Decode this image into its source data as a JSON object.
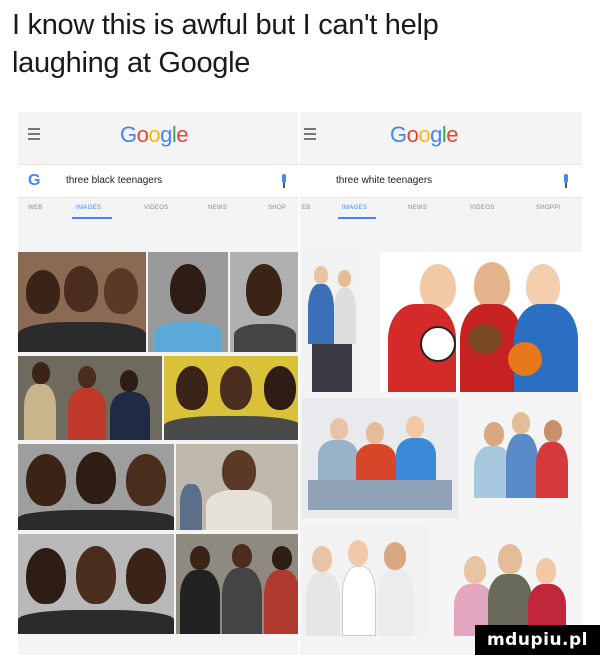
{
  "caption": {
    "line1": "I know this is awful but I can't help",
    "line2": "laughing at Google"
  },
  "left": {
    "logo": [
      "G",
      "o",
      "o",
      "g",
      "l",
      "e"
    ],
    "query": "three black teenagers",
    "tabs": [
      "WEB",
      "IMAGES",
      "VIDEOS",
      "NEWS",
      "SHOP"
    ]
  },
  "right": {
    "logo": [
      "G",
      "o",
      "o",
      "g",
      "l",
      "e"
    ],
    "query": "three white teenagers",
    "tabs": [
      "EB",
      "IMAGES",
      "NEWS",
      "VIDEOS",
      "SHOPPI"
    ]
  },
  "colors": {
    "blue": "#4285f4",
    "red": "#ea4335",
    "yellow": "#fbbc05",
    "green": "#34a853"
  },
  "icons": {
    "menu": "hamburger-icon",
    "search_g": "google-g-icon",
    "mic": "microphone-icon"
  },
  "watermark": "mdupiu.pl"
}
